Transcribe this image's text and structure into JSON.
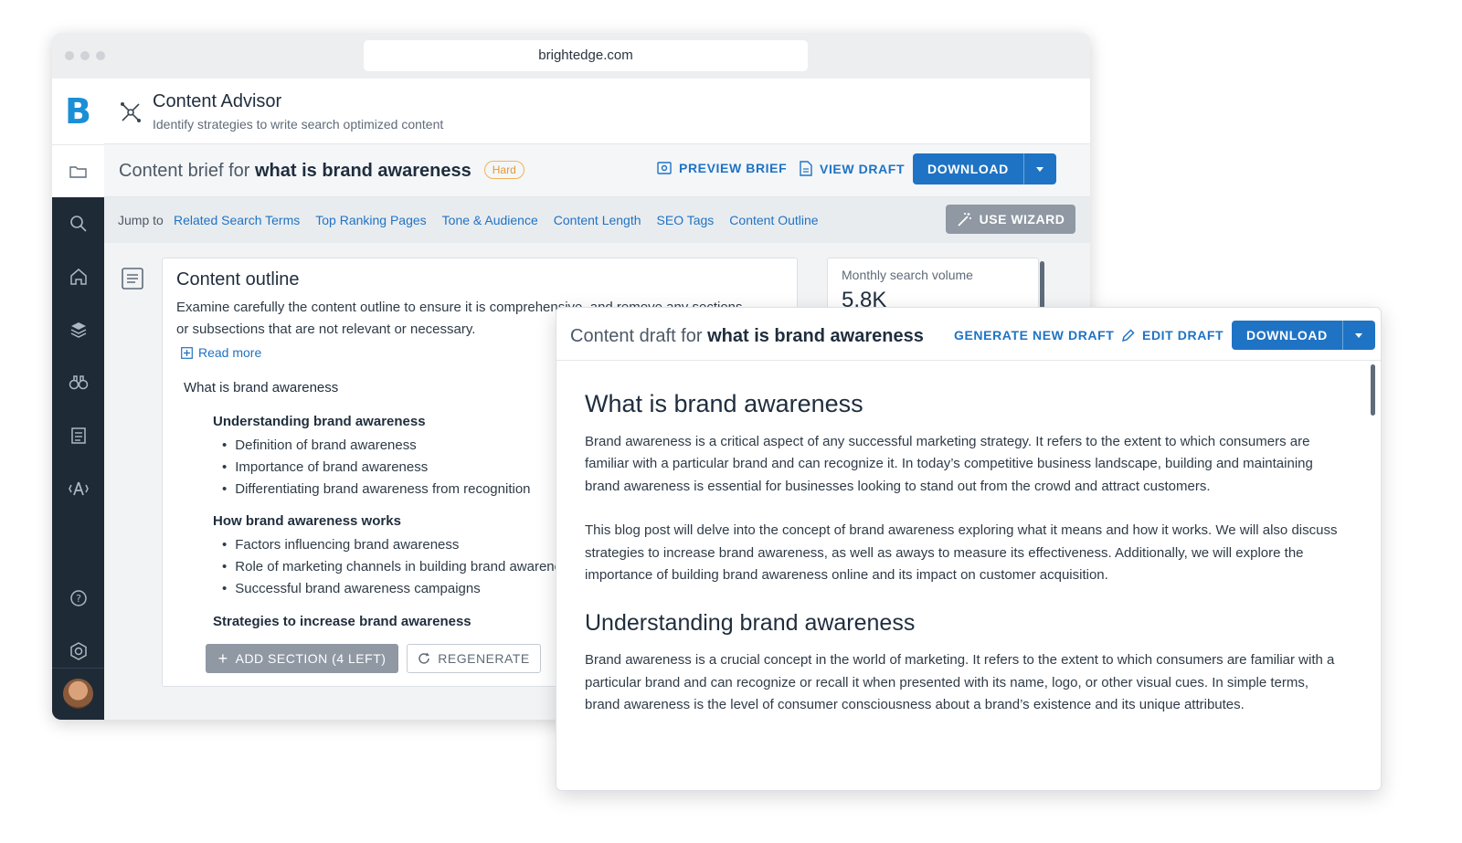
{
  "browser": {
    "url": "brightedge.com"
  },
  "sidebar": {
    "logo": "B"
  },
  "app": {
    "title": "Content Advisor",
    "subtitle": "Identify strategies to write search optimized content"
  },
  "brief": {
    "prefix": "Content brief for ",
    "keyword": "what is brand awareness",
    "difficulty": "Hard",
    "preview_label": "PREVIEW BRIEF",
    "view_draft_label": "VIEW DRAFT",
    "download_label": "DOWNLOAD"
  },
  "jump": {
    "label": "Jump to",
    "links": [
      "Related Search Terms",
      "Top Ranking Pages",
      "Tone & Audience",
      "Content Length",
      "SEO Tags",
      "Content Outline"
    ],
    "wizard_label": "USE WIZARD"
  },
  "outline": {
    "title": "Content outline",
    "description": "Examine carefully the content outline to ensure it is comprehensive, and remove any sections or subsections that are not relevant or necessary.",
    "read_more": "Read more",
    "h1": "What is brand awareness",
    "sections": [
      {
        "heading": "Understanding brand awareness",
        "items": [
          "Definition of brand awareness",
          "Importance of brand awareness",
          "Differentiating brand awareness from recognition"
        ]
      },
      {
        "heading": "How brand awareness works",
        "items": [
          "Factors influencing brand awareness",
          "Role of marketing channels in building brand awareness",
          "Successful brand awareness campaigns"
        ]
      },
      {
        "heading": "Strategies to increase brand awareness",
        "items": []
      }
    ],
    "add_section_label": "ADD SECTION (4 LEFT)",
    "regenerate_label": "REGENERATE"
  },
  "metrics": {
    "monthly_search_volume_label": "Monthly search volume",
    "monthly_search_volume_value": "5.8K"
  },
  "draft": {
    "prefix": "Content draft for ",
    "keyword": "what is brand awareness",
    "generate_label": "GENERATE NEW DRAFT",
    "edit_label": "EDIT DRAFT",
    "download_label": "DOWNLOAD",
    "heading1": "What is brand awareness",
    "para1": "Brand awareness is a critical aspect of any successful marketing strategy. It refers to the extent to which consumers are familiar with a particular brand and can recognize it. In today’s competitive business landscape, building and maintaining brand awareness is essential for businesses looking to stand out from the crowd and attract customers.",
    "para2": "This blog post will delve into the concept of brand awareness exploring what it means and how it works. We will also discuss strategies to increase brand awareness, as well as aways to measure its effectiveness. Additionally, we will explore the importance of building brand awareness online and its impact on customer acquisition.",
    "heading2": "Understanding brand awareness",
    "para3": "Brand awareness is a crucial concept in the world of marketing. It refers to the extent to which consumers are familiar with a particular brand and can recognize or recall it when presented with its name, logo, or other visual cues. In simple terms, brand awareness is the level of consumer consciousness about a brand’s existence and its unique attributes."
  },
  "colors": {
    "accent": "#1f73c4",
    "sidebar": "#1e2a36",
    "badge": "#f0b45b",
    "logo": "#1a8fd6"
  }
}
